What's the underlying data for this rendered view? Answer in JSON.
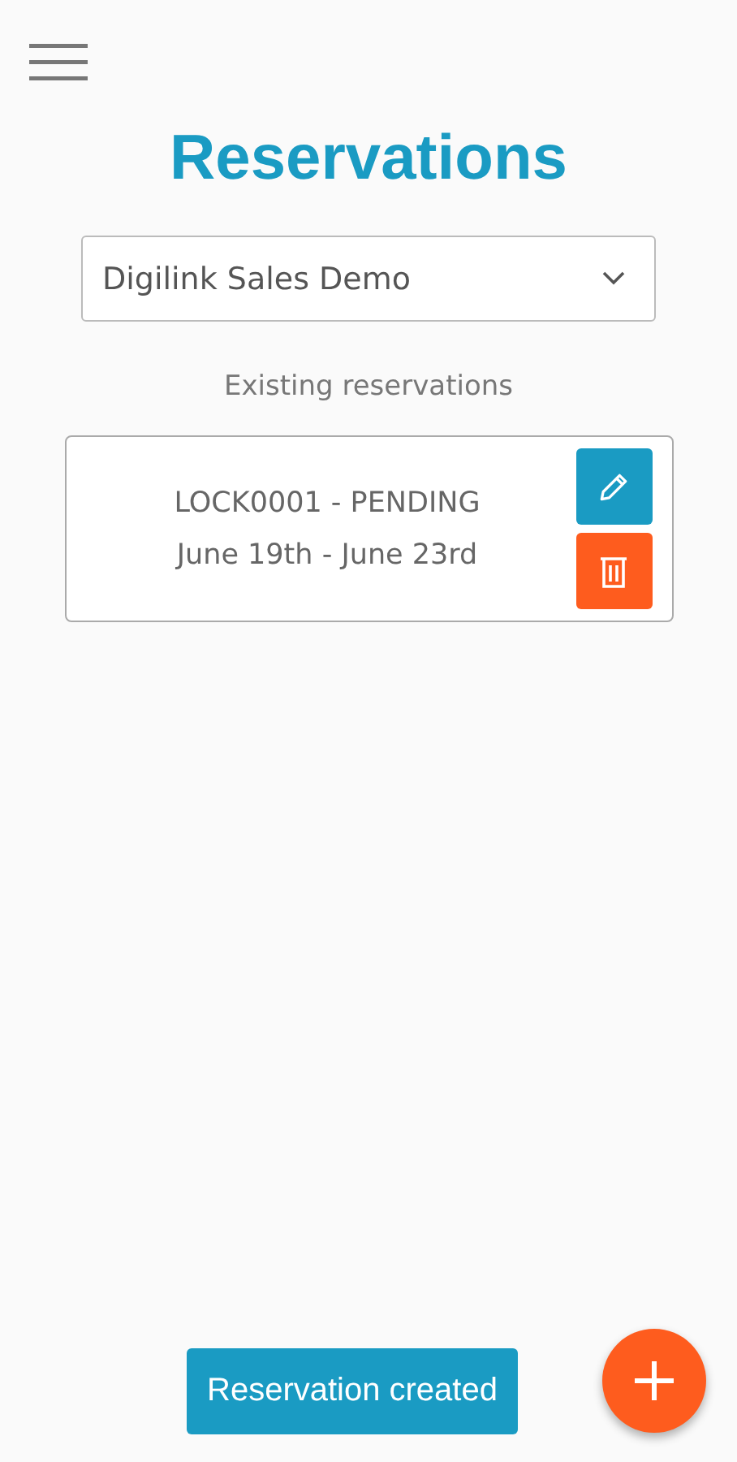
{
  "title": "Reservations",
  "location_select": {
    "value": "Digilink Sales Demo"
  },
  "section_label": "Existing reservations",
  "reservations": [
    {
      "line_1": "LOCK0001 - PENDING",
      "line_2": "June 19th - June 23rd"
    }
  ],
  "snackbar": "Reservation created"
}
